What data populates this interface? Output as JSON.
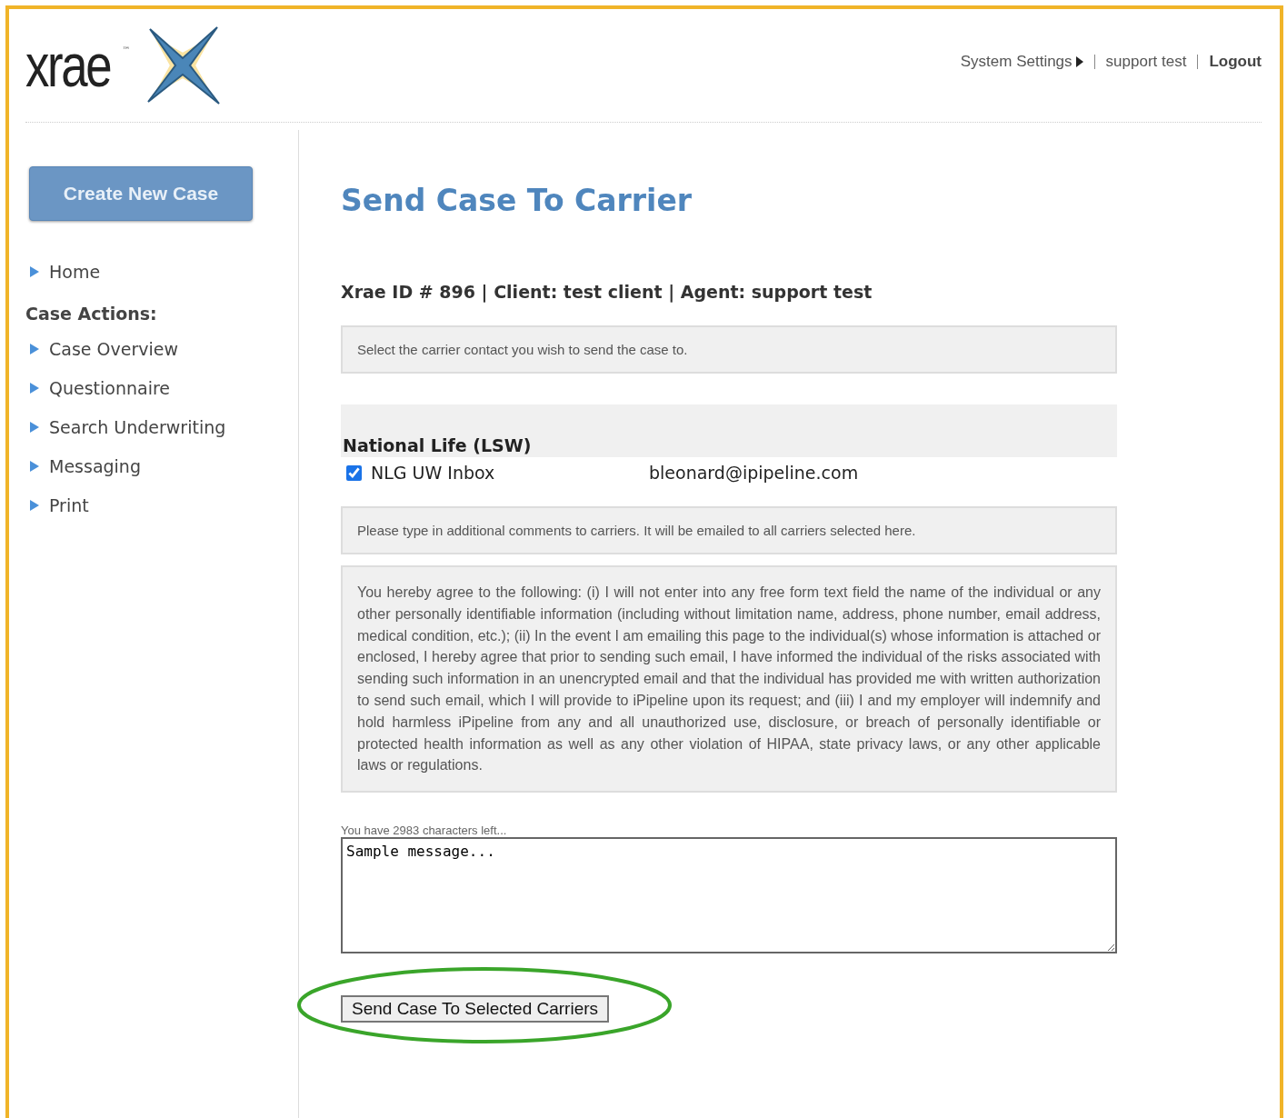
{
  "logo": {
    "text": "xrae",
    "trademark": "™"
  },
  "top_nav": [
    {
      "label": "System Settings",
      "kind": "menu"
    },
    {
      "label": "support test",
      "kind": "link"
    },
    {
      "label": "Logout",
      "kind": "strong"
    }
  ],
  "sidebar": {
    "create_button": "Create New Case",
    "items": [
      {
        "label": "Home"
      }
    ],
    "section_title": "Case Actions:",
    "case_actions": [
      {
        "label": "Case Overview"
      },
      {
        "label": "Questionnaire"
      },
      {
        "label": "Search Underwriting"
      },
      {
        "label": "Messaging"
      },
      {
        "label": "Print"
      }
    ]
  },
  "page_title": "Send Case To Carrier",
  "case_info": "Xrae ID # 896 | Client: test client | Agent: support test",
  "instruction": "Select the carrier contact you wish to send the case to.",
  "carriers": [
    {
      "name": "National Life (LSW)",
      "contacts": [
        {
          "label": "NLG UW Inbox",
          "email": "bleonard@ipipeline.com",
          "checked": true
        }
      ]
    }
  ],
  "comments_note": "Please type in additional comments to carriers. It will be emailed to all carriers selected here.",
  "agreement": "You hereby agree to the following: (i) I will not enter into any free form text field the name of the individual or any other personally identifiable information (including without limitation name, address, phone number, email address, medical condition, etc.); (ii) In the event I am emailing this page to the individual(s) whose information is attached or enclosed, I hereby agree that prior to sending such email, I have informed the individual of the risks associated with sending such information in an unencrypted email and that the individual has provided me with written authorization to send such email, which I will provide to iPipeline upon its request; and (iii) I and my employer will indemnify and hold harmless iPipeline from any and all unauthorized use, disclosure, or breach of personally identifiable or protected health information as well as any other violation of HIPAA, state privacy laws, or any other applicable laws or regulations.",
  "chars_left": "You have 2983 characters left...",
  "message": {
    "value": "Sample message..."
  },
  "submit_button": "Send Case To Selected Carriers"
}
